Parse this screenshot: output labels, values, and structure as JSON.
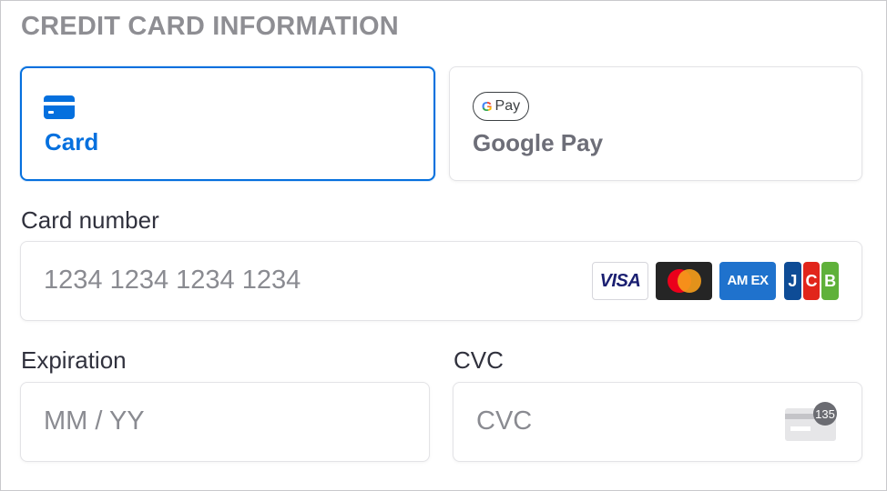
{
  "section_title": "CREDIT CARD INFORMATION",
  "payment_methods": [
    {
      "label": "Card",
      "icon": "credit-card-icon",
      "selected": true
    },
    {
      "label": "Google Pay",
      "icon": "google-pay-icon",
      "badge_text": "Pay",
      "selected": false
    }
  ],
  "card_number": {
    "label": "Card number",
    "placeholder": "1234 1234 1234 1234",
    "brands": [
      {
        "name": "visa",
        "text": "VISA"
      },
      {
        "name": "mastercard"
      },
      {
        "name": "amex",
        "text": "AM EX"
      },
      {
        "name": "jcb",
        "text": [
          "J",
          "C",
          "B"
        ]
      }
    ]
  },
  "expiration": {
    "label": "Expiration",
    "placeholder": "MM / YY"
  },
  "cvc": {
    "label": "CVC",
    "placeholder": "CVC",
    "icon_text": "135"
  },
  "colors": {
    "accent": "#0570de",
    "border": "#e3e3e6",
    "muted": "#8e8e93"
  }
}
